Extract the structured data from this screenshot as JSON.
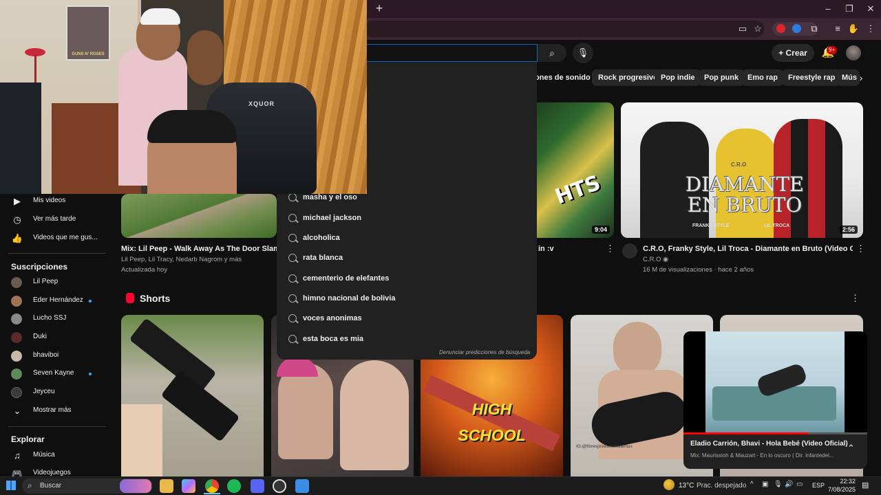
{
  "browser": {
    "new_tab_glyph": "+",
    "window_controls": [
      "–",
      "❐",
      "✕"
    ],
    "toolbar_icons": [
      "cast-icon",
      "bookmark-star-icon",
      "extension-icon",
      "extension-icon",
      "puzzle-icon",
      "media-icon",
      "profile-icon",
      "menu-icon"
    ]
  },
  "youtube": {
    "create_label": "Crear",
    "notif_badge": "9+",
    "chips": [
      "iones de sonido",
      "Rock progresivo",
      "Pop indie",
      "Pop punk",
      "Emo rap",
      "Freestyle rap",
      "Mús"
    ],
    "accent": "#ff0000"
  },
  "sidebar": {
    "top_items": [
      {
        "label": "Mis videos",
        "icon": "play-square-icon"
      },
      {
        "label": "Ver más tarde",
        "icon": "clock-icon"
      },
      {
        "label": "Videos que me gus...",
        "icon": "thumbs-up-icon"
      }
    ],
    "subs_heading": "Suscripciones",
    "subscriptions": [
      {
        "label": "Lil Peep",
        "dot": false,
        "color": "#6b5a50"
      },
      {
        "label": "Eder Hernández",
        "dot": true,
        "color": "#a27255"
      },
      {
        "label": "Lucho SSJ",
        "dot": false,
        "color": "#8a8a8a"
      },
      {
        "label": "Duki",
        "dot": false,
        "color": "#5a2a2a"
      },
      {
        "label": "bhaviboi",
        "dot": false,
        "color": "#c9b9a8"
      },
      {
        "label": "Seven Kayne",
        "dot": true,
        "color": "#5d8a5d"
      },
      {
        "label": "Jeyceu",
        "dot": false,
        "color": "#3a3a3a"
      }
    ],
    "show_more": "Mostrar más",
    "explore_heading": "Explorar",
    "explore_items": [
      {
        "label": "Música",
        "icon": "music-note-icon"
      },
      {
        "label": "Videojuegos",
        "icon": "gamepad-icon"
      }
    ]
  },
  "videos": [
    {
      "title": "Mix: Lil Peep - Walk Away As The Door Slams (C",
      "meta1": "Lil Peep, Lil Tracy, Nedarb Nagrom y más",
      "meta2": "Actualizada hoy"
    },
    {
      "title": "in :v",
      "duration": "9:04",
      "art_text": "HTS"
    },
    {
      "title": "C.R.O, Franky Style, Lil Troca - Diamante en Bruto (Video Oficial)",
      "channel": "C.R.O",
      "meta2": "16 M de visualizaciones · hace 2 años",
      "duration": "2:56",
      "art_title": "DIAMANTE EN BRUTO",
      "art_left": "FRANKY STYLE",
      "art_right": "LIL TROCA",
      "art_top": "C.R.O"
    }
  ],
  "shorts": {
    "heading": "Shorts",
    "card3_text_1": "HIGH",
    "card3_text_2": "SCHOOL",
    "card4_watermark": "IG:@floresjoseluisoficialmus"
  },
  "suggestions": {
    "items": [
      "masha y el oso",
      "michael jackson",
      "alcoholica",
      "rata blanca",
      "cementerio de elefantes",
      "himno nacional de bolivia",
      "voces anonimas",
      "esta boca es mia"
    ],
    "report": "Denunciar predicciones de búsqueda"
  },
  "webcam": {
    "poster_text": "GUNS N' ROSES",
    "chair_brand": "XQUOR"
  },
  "miniplayer": {
    "title": "Eladio Carrión, Bhavi - Hola Bebé (Video Oficial)",
    "subtitle": "Mix: Maurissioh & Mauzart - En lo oscuro ( Dir. infantedel...",
    "progress": 0.68
  },
  "taskbar": {
    "search_label": "Buscar",
    "temperature": "13°C",
    "weather": "Prac. despejado",
    "language": "ESP",
    "time": "22:32",
    "date": "7/08/2025"
  }
}
